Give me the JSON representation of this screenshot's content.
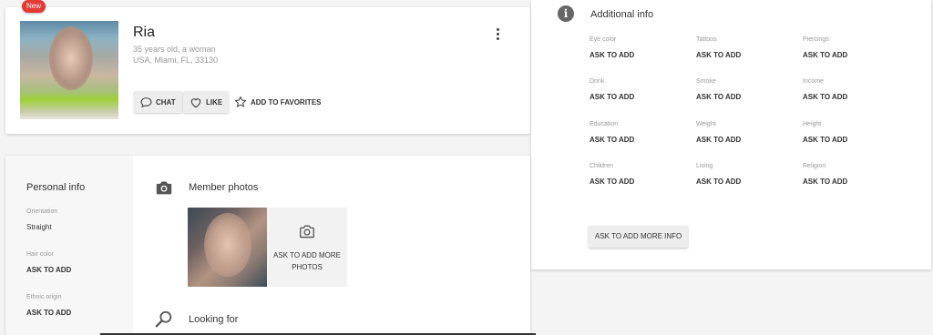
{
  "profile": {
    "badge": "New",
    "name": "Ria",
    "age_gender": "35 years old, a woman",
    "location": "USA, Miami, FL, 33130",
    "buttons": {
      "chat": "CHAT",
      "like": "LIKE",
      "favorites": "ADD TO FAVORITES"
    }
  },
  "additional": {
    "title": "Additional info",
    "items": [
      {
        "key": "Eye color",
        "value": "ASK TO ADD"
      },
      {
        "key": "Tattoos",
        "value": "ASK TO ADD"
      },
      {
        "key": "Piercings",
        "value": "ASK TO ADD"
      },
      {
        "key": "Drink",
        "value": "ASK TO ADD"
      },
      {
        "key": "Smoke",
        "value": "ASK TO ADD"
      },
      {
        "key": "Income",
        "value": "ASK TO ADD"
      },
      {
        "key": "Education",
        "value": "ASK TO ADD"
      },
      {
        "key": "Weight",
        "value": "ASK TO ADD"
      },
      {
        "key": "Height",
        "value": "ASK TO ADD"
      },
      {
        "key": "Children",
        "value": "ASK TO ADD"
      },
      {
        "key": "Living",
        "value": "ASK TO ADD"
      },
      {
        "key": "Religion",
        "value": "ASK TO ADD"
      }
    ],
    "more_button": "ASK TO ADD MORE INFO"
  },
  "personal": {
    "title": "Personal info",
    "items": [
      {
        "key": "Orientation",
        "value": "Straight"
      },
      {
        "key": "Hair color",
        "value": "ASK TO ADD"
      },
      {
        "key": "Ethnic origin",
        "value": "ASK TO ADD"
      }
    ]
  },
  "photos": {
    "title": "Member photos",
    "add_label": "ASK TO ADD MORE PHOTOS"
  },
  "looking_for": {
    "title": "Looking for"
  }
}
